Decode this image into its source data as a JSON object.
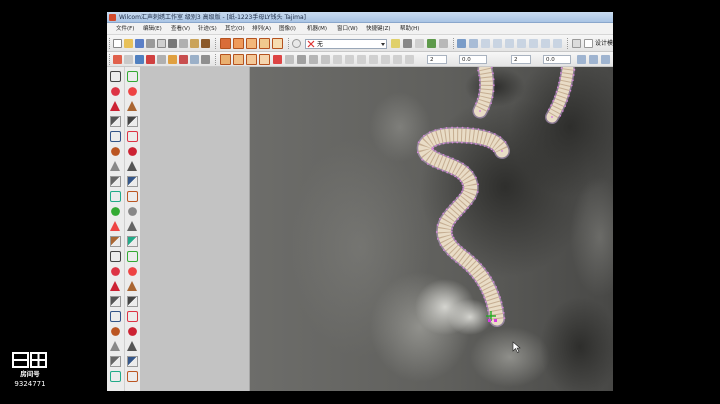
{
  "window": {
    "title": "Wilcom汇声刺绣工作室  级别3 高级版 - [纸-1223手母LY钱头    Tajima]"
  },
  "menu": {
    "items": [
      {
        "label": "文件(F)"
      },
      {
        "label": "编辑(E)"
      },
      {
        "label": "查看(V)"
      },
      {
        "label": "针迹(S)"
      },
      {
        "label": "其它(O)"
      },
      {
        "label": "排列(A)"
      },
      {
        "label": "图像(I)"
      },
      {
        "label": "机器(M)"
      },
      {
        "label": "窗口(W)"
      },
      {
        "label": "快捷键(Z)"
      },
      {
        "label": "帮助(H)"
      }
    ]
  },
  "toolbar": {
    "color_combo_value": "无",
    "mode_label": "设计模",
    "spin_values": [
      "2",
      "0.0",
      "2",
      "0.0"
    ]
  },
  "watermark": {
    "logo_text": "斗鱼",
    "sub_text": "房间号",
    "room_id": "9324771"
  },
  "colors": {
    "stitch_fill": "#e9dcc6",
    "stitch_outline": "#c8a9d8",
    "stitch_point": "#d68ad9",
    "cursor_cross": "#22aa22",
    "panel_gray": "#c3c3c3"
  }
}
